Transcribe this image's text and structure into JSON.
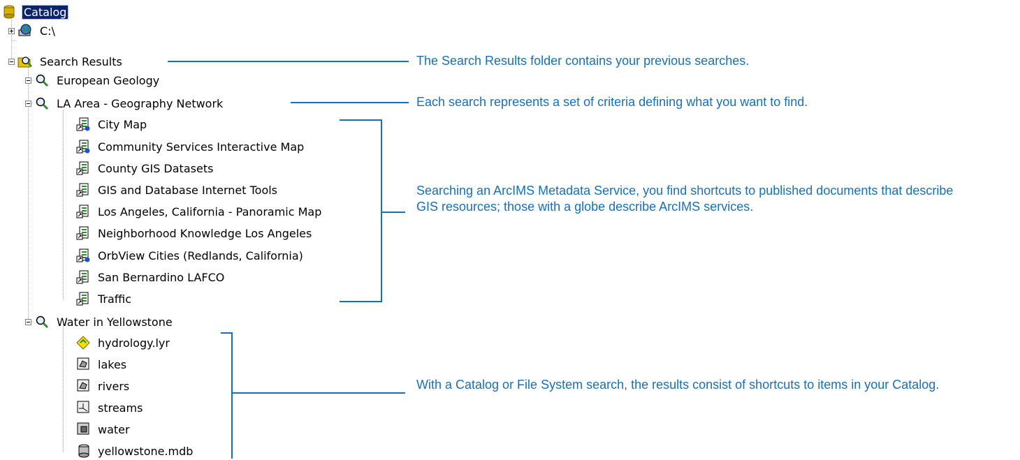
{
  "tree": {
    "root": {
      "label": "Catalog",
      "icon": "database-root-icon"
    },
    "drive": {
      "label": "C:\\",
      "icon": "globe-drive-icon"
    },
    "search_results": {
      "label": "Search Results",
      "icon": "search-folder-icon"
    },
    "searches": [
      {
        "label": "European Geology",
        "icon": "magnifier-icon"
      },
      {
        "label": "LA Area - Geography Network",
        "icon": "magnifier-icon",
        "items": [
          {
            "label": "City Map",
            "icon": "metadata-globe-shortcut-icon"
          },
          {
            "label": "Community Services Interactive Map",
            "icon": "metadata-globe-shortcut-icon"
          },
          {
            "label": "County GIS Datasets",
            "icon": "metadata-shortcut-icon"
          },
          {
            "label": "GIS and Database Internet Tools",
            "icon": "metadata-shortcut-icon"
          },
          {
            "label": "Los Angeles, California - Panoramic Map",
            "icon": "metadata-shortcut-icon"
          },
          {
            "label": "Neighborhood Knowledge Los Angeles",
            "icon": "metadata-shortcut-icon"
          },
          {
            "label": "OrbView Cities (Redlands, California)",
            "icon": "metadata-globe-shortcut-icon"
          },
          {
            "label": "San Bernardino LAFCO",
            "icon": "metadata-shortcut-icon"
          },
          {
            "label": "Traffic",
            "icon": "metadata-shortcut-icon"
          }
        ]
      },
      {
        "label": "Water in Yellowstone",
        "icon": "magnifier-icon",
        "items": [
          {
            "label": "hydrology.lyr",
            "icon": "layer-file-icon"
          },
          {
            "label": "lakes",
            "icon": "polygon-shapefile-icon"
          },
          {
            "label": "rivers",
            "icon": "polygon-shapefile-icon"
          },
          {
            "label": "streams",
            "icon": "line-shapefile-icon"
          },
          {
            "label": "water",
            "icon": "coverage-icon"
          },
          {
            "label": "yellowstone.mdb",
            "icon": "geodatabase-icon"
          }
        ]
      }
    ]
  },
  "callouts": {
    "search_results": "The Search Results folder contains your previous searches.",
    "search": "Each search represents a set of criteria defining what you want to find.",
    "metadata": "Searching an ArcIMS Metadata Service, you find shortcuts to published documents that describe GIS resources; those with a globe describe ArcIMS services.",
    "catalog": "With a Catalog or File System search, the results consist of shortcuts to items in your Catalog."
  },
  "colors": {
    "callout_text": "#1a6fb4",
    "callout_line": "#1a6fb4",
    "selection": "#0a246a"
  }
}
